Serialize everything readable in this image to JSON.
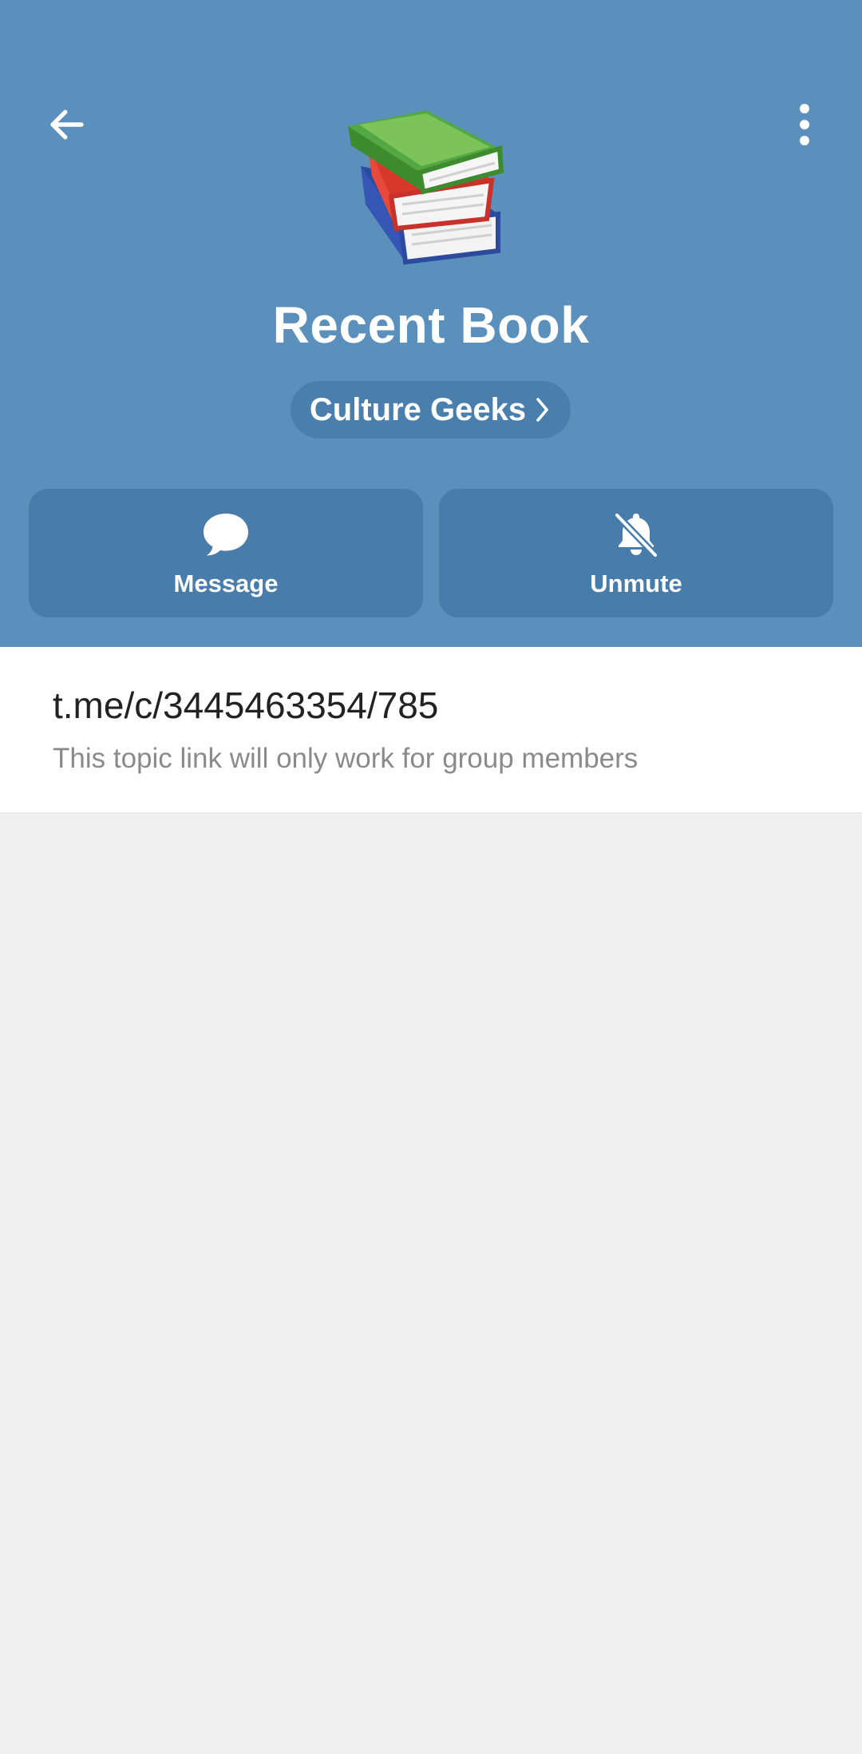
{
  "header": {
    "title": "Recent Book",
    "group_name": "Culture Geeks",
    "back_icon": "arrow-left-icon",
    "more_icon": "vertical-dots-icon",
    "topic_icon": "books-emoji-icon",
    "background_color": "#5b8fbc"
  },
  "actions": {
    "message_label": "Message",
    "unmute_label": "Unmute"
  },
  "link_card": {
    "link": "t.me/c/3445463354/785",
    "description": "This topic link will only work for group members"
  }
}
